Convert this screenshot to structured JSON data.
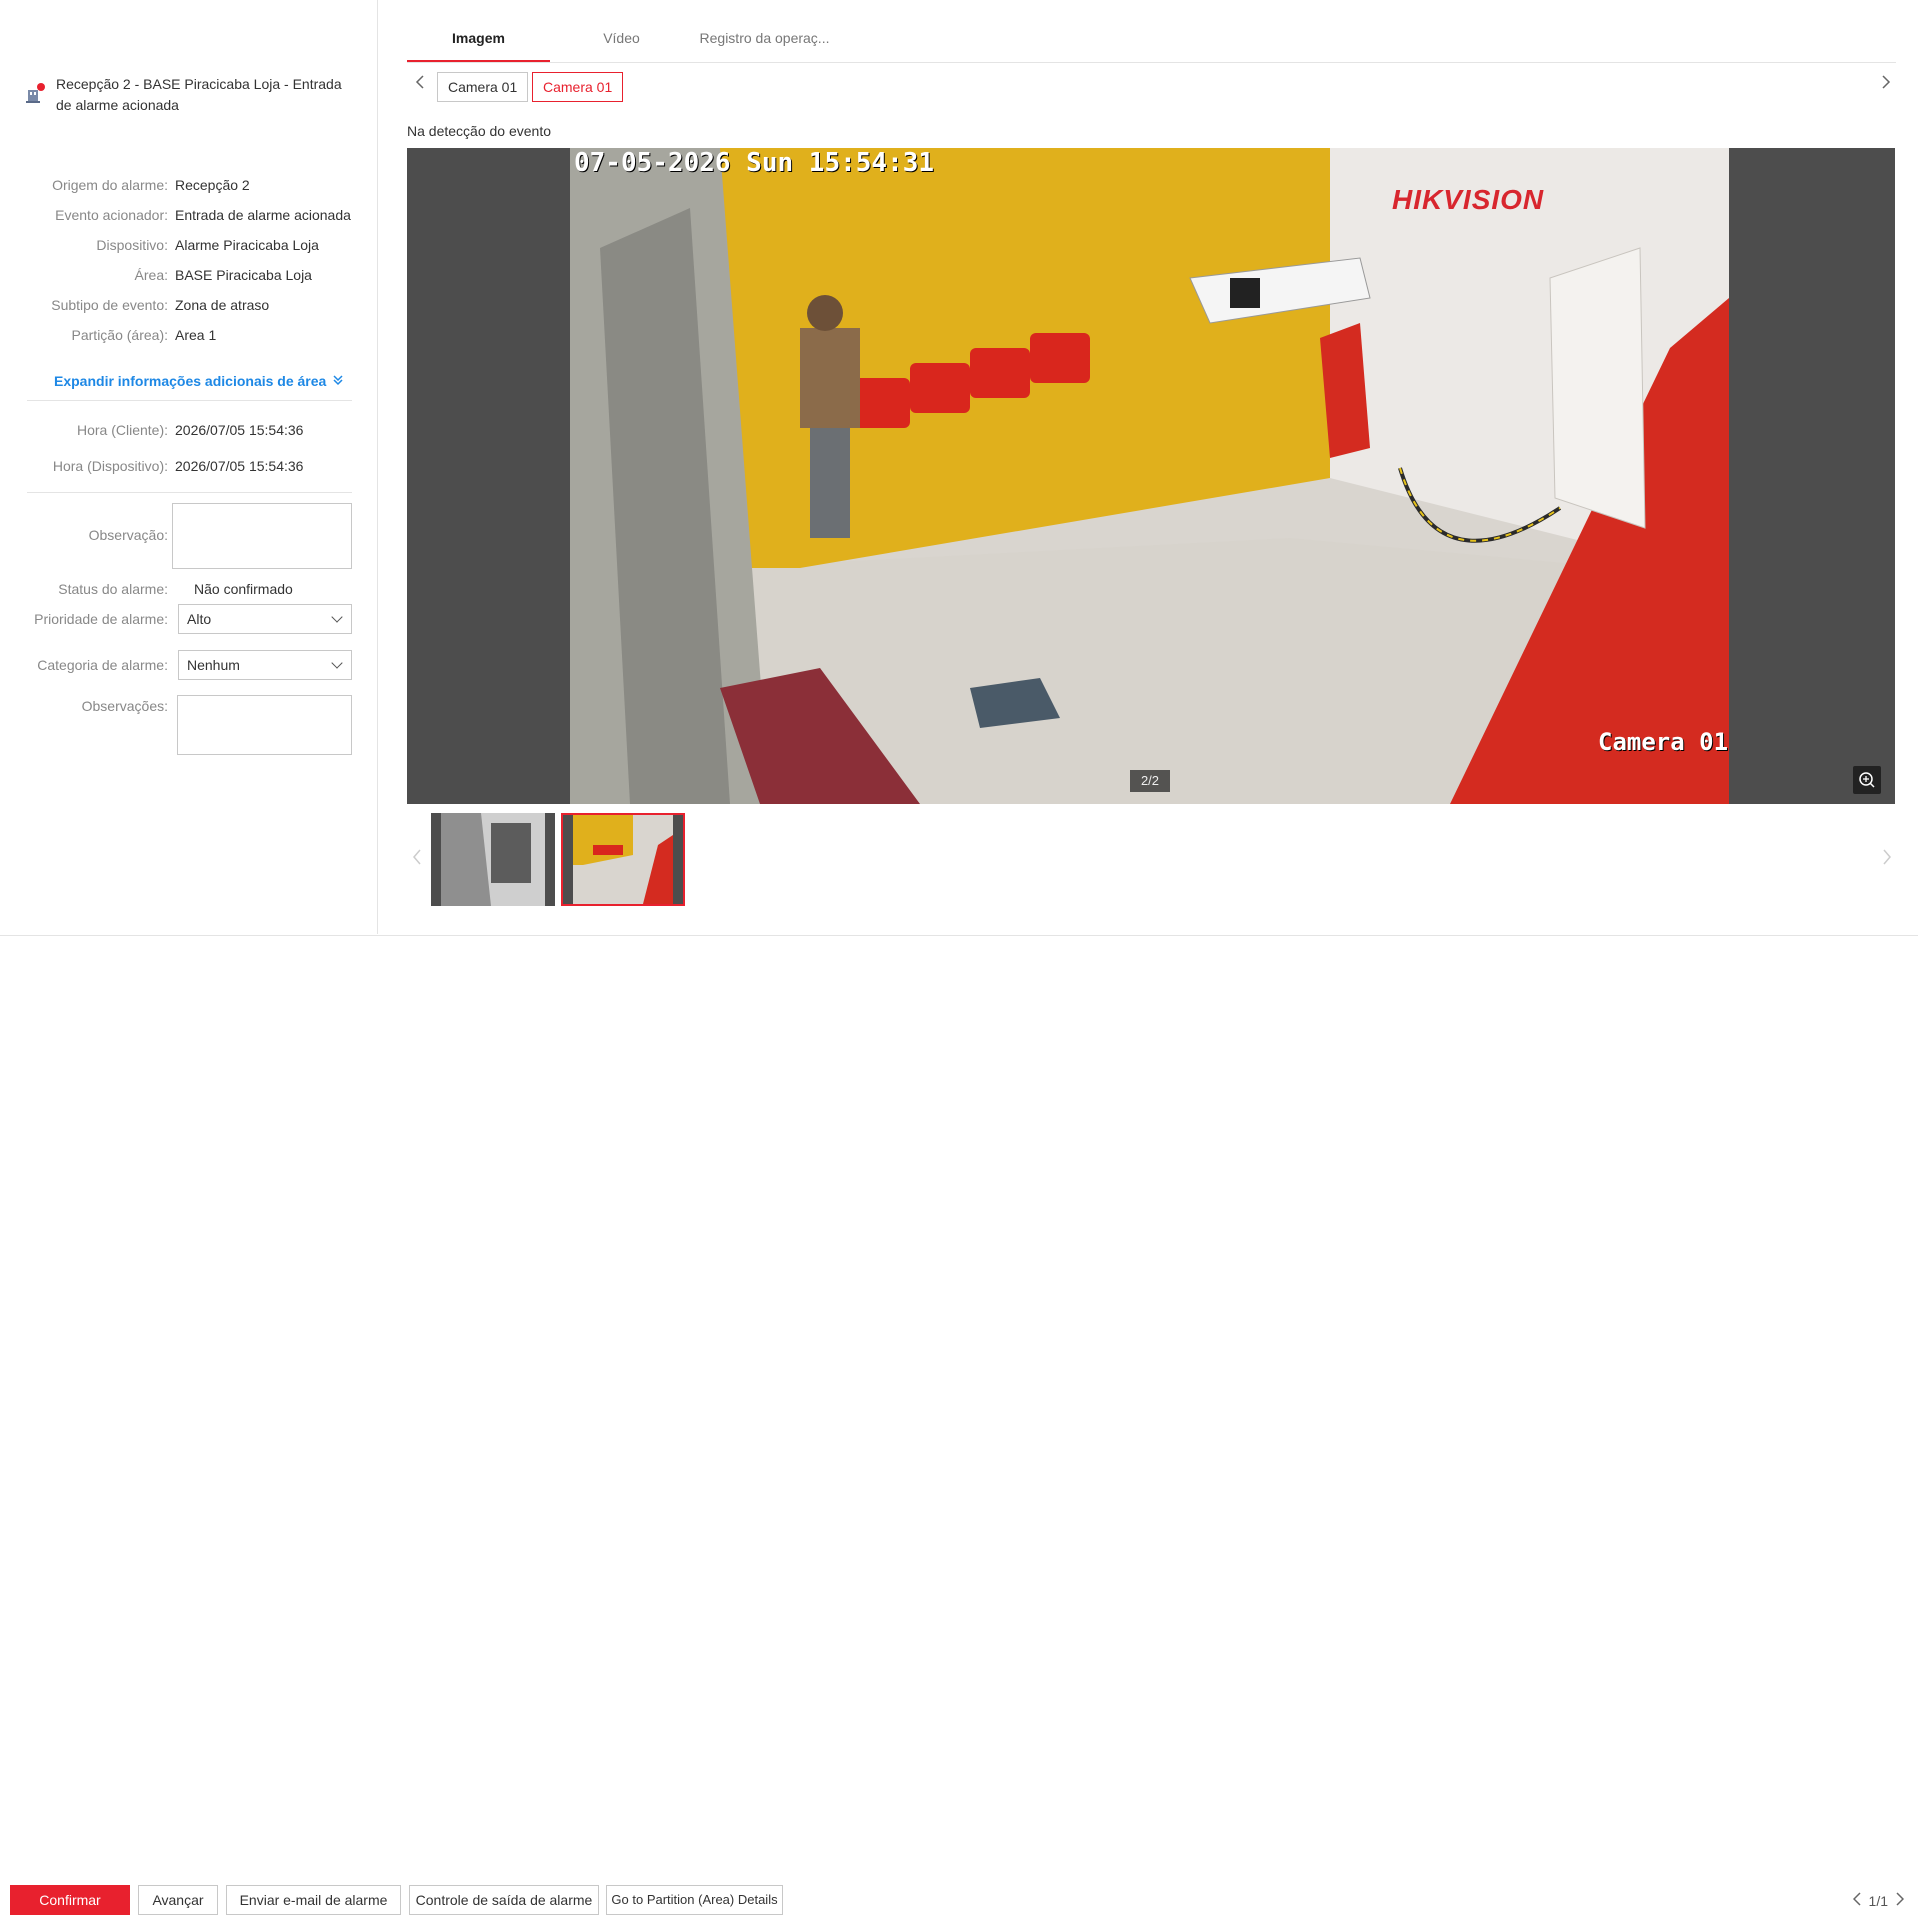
{
  "alarm": {
    "title": "Recepção 2 - BASE Piracicaba Loja - Entrada de alarme acionada"
  },
  "details": [
    {
      "label": "Origem do alarme:",
      "value": "Recepção 2"
    },
    {
      "label": "Evento acionador:",
      "value": "Entrada de alarme acionada"
    },
    {
      "label": "Dispositivo:",
      "value": "Alarme Piracicaba Loja"
    },
    {
      "label": "Área:",
      "value": "BASE Piracicaba Loja"
    },
    {
      "label": "Subtipo de evento:",
      "value": "Zona de atraso"
    },
    {
      "label": "Partição (área):",
      "value": "Area 1"
    }
  ],
  "expand_label": "Expandir informações adicionais de área",
  "times": [
    {
      "label": "Hora (Cliente):",
      "value": "2026/07/05 15:54:36"
    },
    {
      "label": "Hora (Dispositivo):",
      "value": "2026/07/05 15:54:36"
    }
  ],
  "form": {
    "observation_label": "Observação:",
    "observation_value": "",
    "status_label": "Status do alarme:",
    "status_value": "Não confirmado",
    "priority_label": "Prioridade de alarme:",
    "priority_value": "Alto",
    "category_label": "Categoria de alarme:",
    "category_value": "Nenhum",
    "remarks_label": "Observações:",
    "remarks_value": ""
  },
  "tabs": [
    "Imagem",
    "Vídeo",
    "Registro da operaç..."
  ],
  "active_tab": 0,
  "cameras": [
    "Camera 01",
    "Camera 01"
  ],
  "active_camera": 1,
  "caption": "Na detecção do evento",
  "image": {
    "osd_time": "07-05-2026 Sun 15:54:31",
    "osd_brand_a": "HIK",
    "osd_brand_b": "VISION",
    "osd_camera": "Camera 01",
    "counter": "2/2"
  },
  "footer": {
    "confirm": "Confirmar",
    "next": "Avançar",
    "email": "Enviar e-mail de alarme",
    "output": "Controle de saída de alarme",
    "partition": "Go to Partition (Area) Details",
    "page": "1/1"
  },
  "colors": {
    "accent": "#e8212e",
    "link": "#1e88e5"
  }
}
